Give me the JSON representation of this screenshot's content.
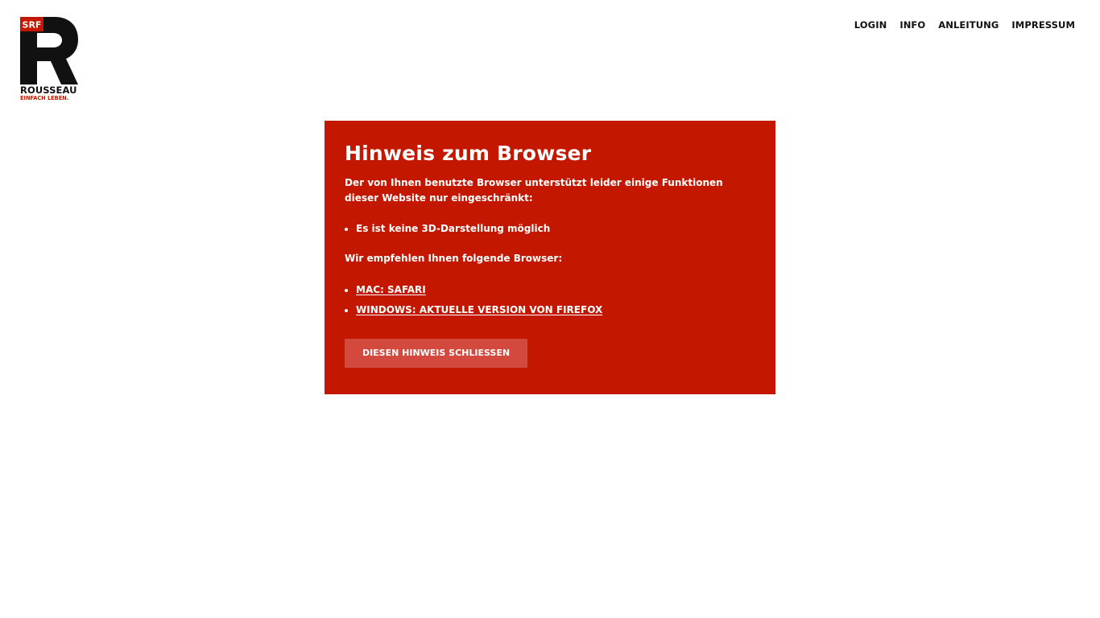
{
  "logo": {
    "badge_text": "SRF",
    "letter": "R",
    "name": "ROUSSEAU",
    "tagline": "EINFACH LEBEN.",
    "badge_color": "#c41700"
  },
  "nav": {
    "items": [
      {
        "label": "LOGIN"
      },
      {
        "label": "INFO"
      },
      {
        "label": "ANLEITUNG"
      },
      {
        "label": "IMPRESSUM"
      }
    ]
  },
  "notice": {
    "background_color": "#c41700",
    "title": "Hinweis zum Browser",
    "intro": "Der von Ihnen benutzte Browser unterstützt leider einige Funktionen dieser Website nur eingeschränkt:",
    "issues": [
      "Es ist keine 3D-Darstellung möglich"
    ],
    "recommend_text": "Wir empfehlen Ihnen folgende Browser:",
    "browsers": [
      {
        "label": "MAC: SAFARI"
      },
      {
        "label": "WINDOWS: AKTUELLE VERSION VON FIREFOX"
      }
    ],
    "close_button_label": "DIESEN HINWEIS SCHLIESSEN",
    "close_button_color": "#d4493d"
  }
}
